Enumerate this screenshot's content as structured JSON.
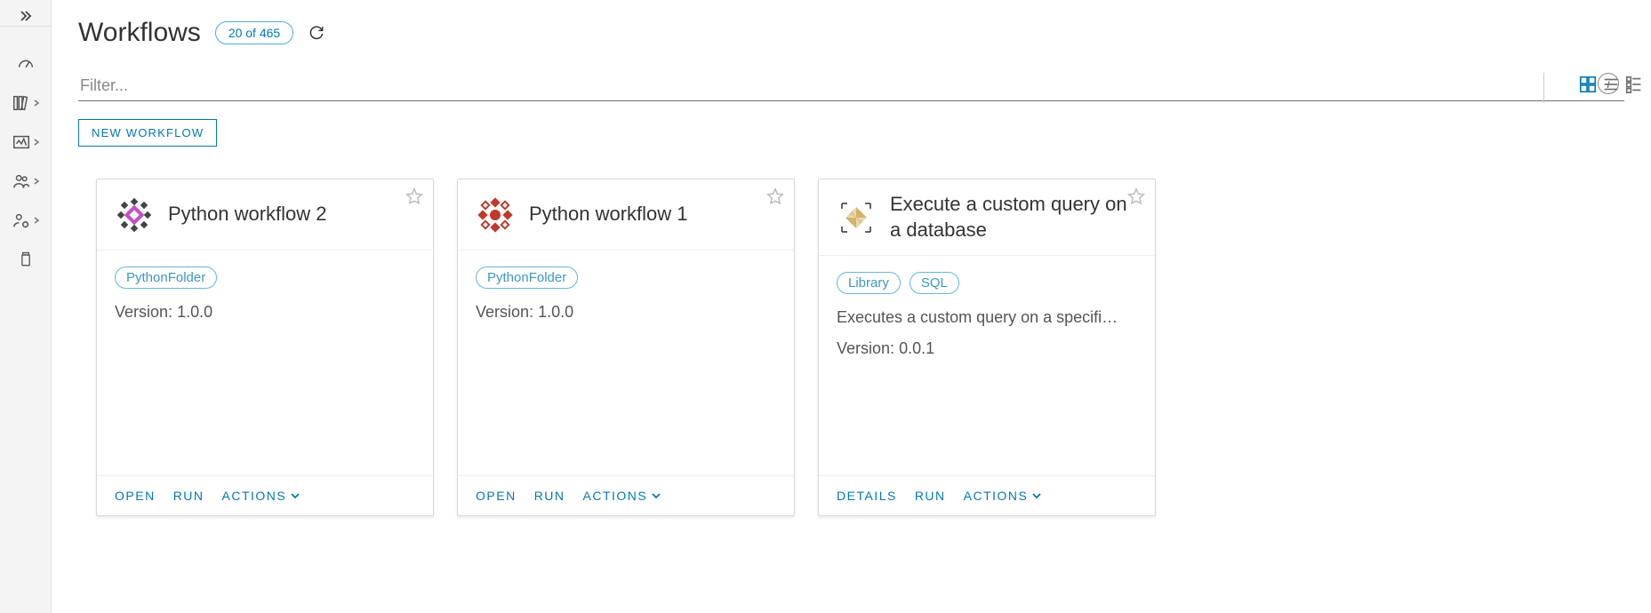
{
  "header": {
    "title": "Workflows",
    "count_badge": "20 of 465"
  },
  "filter": {
    "placeholder": "Filter..."
  },
  "buttons": {
    "new_workflow": "NEW WORKFLOW"
  },
  "action_labels": {
    "open": "OPEN",
    "run": "RUN",
    "details": "DETAILS",
    "actions": "ACTIONS"
  },
  "version_label": "Version:",
  "cards": [
    {
      "title": "Python workflow 2",
      "tags": [
        "PythonFolder"
      ],
      "description": "",
      "version": "1.0.0",
      "primary_action": "open",
      "icon_style": "pink"
    },
    {
      "title": "Python workflow 1",
      "tags": [
        "PythonFolder"
      ],
      "description": "",
      "version": "1.0.0",
      "primary_action": "open",
      "icon_style": "red"
    },
    {
      "title": "Execute a custom query on a database",
      "tags": [
        "Library",
        "SQL"
      ],
      "description": "Executes a custom query on a specifi…",
      "version": "0.0.1",
      "primary_action": "details",
      "icon_style": "tan"
    }
  ]
}
